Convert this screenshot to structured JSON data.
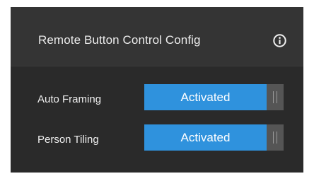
{
  "panel": {
    "title": "Remote Button Control Config",
    "info_icon": "info-icon"
  },
  "settings": [
    {
      "label": "Auto Framing",
      "state_label": "Activated",
      "active": true
    },
    {
      "label": "Person Tiling",
      "state_label": "Activated",
      "active": true
    }
  ],
  "colors": {
    "accent": "#2f92dd",
    "panel_bg": "#323232",
    "body_bg": "#2a2a2a",
    "handle_bg": "#555555"
  }
}
